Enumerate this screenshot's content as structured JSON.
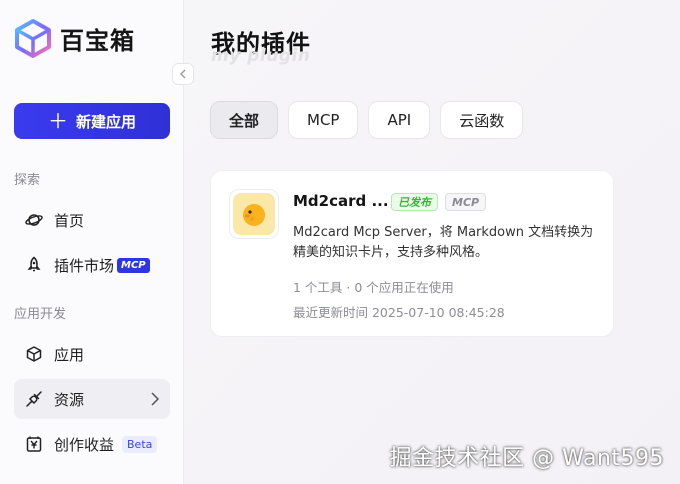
{
  "app": {
    "logo_text": "百宝箱"
  },
  "sidebar": {
    "new_app_label": "新建应用",
    "sections": [
      {
        "label": "探索"
      },
      {
        "label": "应用开发"
      }
    ],
    "items": [
      {
        "label": "首页"
      },
      {
        "label": "插件市场",
        "badge": "MCP"
      },
      {
        "label": "应用"
      },
      {
        "label": "资源"
      },
      {
        "label": "创作收益",
        "badge": "Beta"
      }
    ]
  },
  "main": {
    "title": "我的插件",
    "subtitle": "my plugin",
    "filters": [
      "全部",
      "MCP",
      "API",
      "云函数"
    ],
    "card": {
      "name": "Md2card ...",
      "status": "已发布",
      "type": "MCP",
      "description": "Md2card Mcp Server，将 Markdown 文档转换为精美的知识卡片，支持多种风格。",
      "meta": "1 个工具 · 0 个应用正在使用",
      "updated": "最近更新时间 2025-07-10 08:45:28"
    }
  },
  "watermark": "掘金技术社区 @ Want595",
  "colors": {
    "accent": "#3a3bf0",
    "published": "#3bb43a"
  }
}
